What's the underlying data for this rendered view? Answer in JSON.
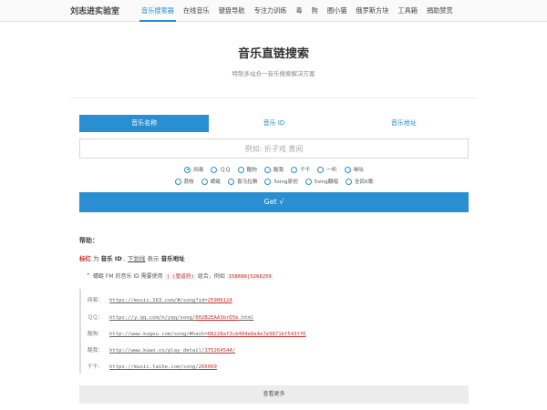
{
  "nav": {
    "brand": "刘志进实验室",
    "items": [
      "音乐搜索器",
      "在线音乐",
      "键盘导航",
      "专注力训练",
      "毒",
      "狗",
      "圈小猫",
      "俄罗斯方块",
      "工具箱",
      "捐助赞赏"
    ],
    "active_index": 0
  },
  "header": {
    "title": "音乐直链搜索",
    "subtitle": "特制多站合一音乐搜索解决方案"
  },
  "tabs": [
    "音乐名称",
    "音乐 ID",
    "音乐地址"
  ],
  "search": {
    "placeholder": "例如: 折子戏 黄阅",
    "value": ""
  },
  "sources_row1": [
    "网易",
    "ＱＱ",
    "酷狗",
    "酷我",
    "千千",
    "一听",
    "咪咕"
  ],
  "sources_row2": [
    "荔枝",
    "蜻蜓",
    "喜马拉雅",
    "5sing原创",
    "5sing翻唱",
    "全民K歌"
  ],
  "selected_source": "网易",
  "submit_label": "Get √",
  "help": {
    "title": "帮助：",
    "legend": {
      "red_word": "标红",
      "t1": " 为 ",
      "id_word": "音乐 ID",
      "t2": " , ",
      "underline_word": "下划线",
      "t3": " 表示 ",
      "addr_word": "音乐地址"
    },
    "tip": {
      "t1": "蜻蜓 FM 的音乐 ID 需要使用 ",
      "code1": "| (管道符)",
      "t2": " 组合，例如 ",
      "code2": "158696|5266259"
    }
  },
  "examples": [
    {
      "label": "网易：",
      "url": "https://music.163.com/#/song?id=",
      "id": "25906124"
    },
    {
      "label": "ＱＱ：",
      "url": "https://y.qq.com/n/yqq/song/",
      "id": "002B2EAA3brD5b",
      "suffix": ".html"
    },
    {
      "label": "酷狗：",
      "url": "http://www.kugou.com/song/#hash=",
      "id": "08228af3cb404e8a4e7e9871bf543ff6"
    },
    {
      "label": "酷我：",
      "url": "http://www.kuwo.cn/play_detail/",
      "id": "175264544",
      "suffix": "/"
    },
    {
      "label": "千千：",
      "url": "https://music.taihe.com/song/",
      "id": "266069"
    }
  ],
  "more_label": "查看更多",
  "colors": {
    "accent": "#2a8fd0",
    "highlight": "#c9302c"
  }
}
